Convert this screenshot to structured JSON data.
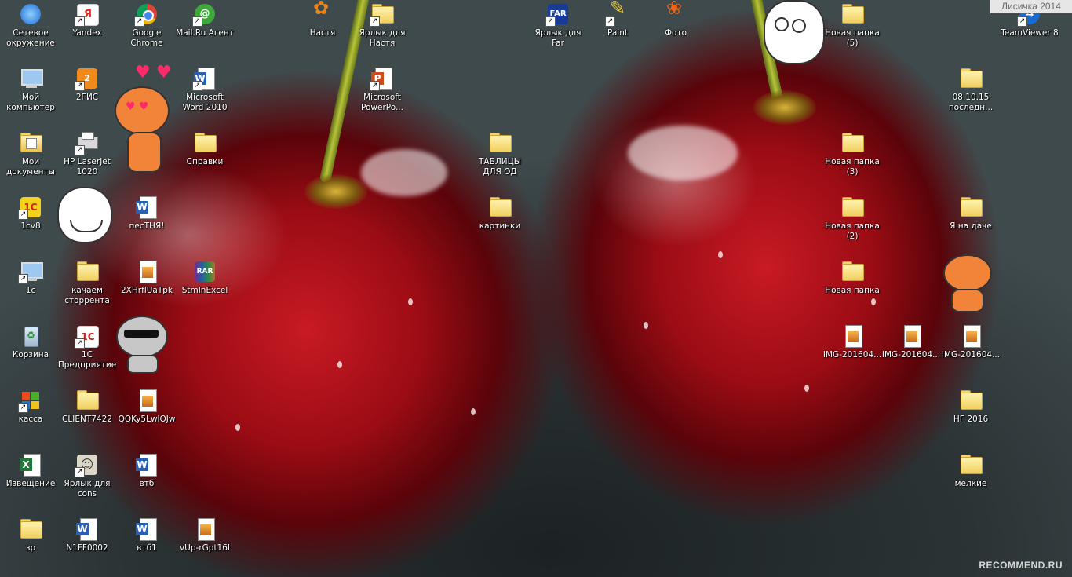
{
  "watermarks": {
    "top_right": "Лисичка 2014",
    "bottom_right": "RECOMMEND.RU"
  },
  "colors": {
    "folder": "#f0cf5e",
    "word_blue": "#2b5fb4",
    "onec_red": "#d0201a",
    "label_text": "#ffffff"
  },
  "icons": [
    {
      "id": "network",
      "label": "Сетевое\nокружение",
      "type": "network",
      "shortcut": false
    },
    {
      "id": "yandex",
      "label": "Yandex",
      "type": "yandex",
      "shortcut": true
    },
    {
      "id": "chrome",
      "label": "Google\nChrome",
      "type": "chrome",
      "shortcut": true
    },
    {
      "id": "mailru",
      "label": "Mail.Ru Агент",
      "type": "mailru",
      "shortcut": true
    },
    {
      "id": "nastya",
      "label": "Настя",
      "type": "butterfly",
      "shortcut": false
    },
    {
      "id": "shortcut-nastya",
      "label": "Ярлык для\nНастя",
      "type": "folder",
      "shortcut": true
    },
    {
      "id": "far",
      "label": "Ярлык для\nFar",
      "type": "far",
      "shortcut": true
    },
    {
      "id": "paint",
      "label": "Paint",
      "type": "paint",
      "shortcut": true
    },
    {
      "id": "foto",
      "label": "Фото",
      "type": "flower",
      "shortcut": false
    },
    {
      "id": "new-folder-5",
      "label": "Новая папка\n(5)",
      "type": "folder",
      "shortcut": false
    },
    {
      "id": "teamviewer",
      "label": "TeamViewer 8",
      "type": "teamviewer",
      "shortcut": true
    },
    {
      "id": "my-computer",
      "label": "Мой\nкомпьютер",
      "type": "computer",
      "shortcut": false
    },
    {
      "id": "2gis",
      "label": "2ГИС",
      "type": "2gis",
      "shortcut": true
    },
    {
      "id": "word2010",
      "label": "Microsoft\nWord 2010",
      "type": "word",
      "shortcut": true
    },
    {
      "id": "powerpoint",
      "label": "Microsoft\nPowerPo...",
      "type": "powerpoint",
      "shortcut": true
    },
    {
      "id": "folder-date",
      "label": "08.10.15\nпоследн...",
      "type": "folder",
      "shortcut": false
    },
    {
      "id": "my-documents",
      "label": "Мои\nдокументы",
      "type": "mydocs",
      "shortcut": false
    },
    {
      "id": "hp-printer",
      "label": "HP LaserJet\n1020",
      "type": "printer",
      "shortcut": true
    },
    {
      "id": "spravki",
      "label": "Справки",
      "type": "folder",
      "shortcut": false
    },
    {
      "id": "tablicy",
      "label": "ТАБЛИЦЫ\nДЛЯ ОД",
      "type": "folder",
      "shortcut": false
    },
    {
      "id": "new-folder-3",
      "label": "Новая папка\n(3)",
      "type": "folder",
      "shortcut": false
    },
    {
      "id": "1cv8",
      "label": "1cv8",
      "type": "onec",
      "shortcut": true
    },
    {
      "id": "pesnya",
      "label": "песТНЯ!",
      "type": "worddoc",
      "shortcut": false
    },
    {
      "id": "kartinki",
      "label": "картинки",
      "type": "folder",
      "shortcut": false
    },
    {
      "id": "new-folder-2",
      "label": "Новая папка\n(2)",
      "type": "folder",
      "shortcut": false
    },
    {
      "id": "ya-na-dache",
      "label": "Я на даче",
      "type": "folder",
      "shortcut": false
    },
    {
      "id": "1c",
      "label": "1с",
      "type": "computer",
      "shortcut": true
    },
    {
      "id": "kachaem",
      "label": "качаем\nсторрента",
      "type": "folder",
      "shortcut": false
    },
    {
      "id": "img-2xhr",
      "label": "2XHrflUaTpk",
      "type": "image",
      "shortcut": false
    },
    {
      "id": "stmin",
      "label": "StmInExcel",
      "type": "rar",
      "shortcut": false
    },
    {
      "id": "new-folder",
      "label": "Новая папка",
      "type": "folder",
      "shortcut": false
    },
    {
      "id": "recycle",
      "label": "Корзина",
      "type": "recycle",
      "shortcut": false
    },
    {
      "id": "1c-enterprise",
      "label": "1С\nПредприятие",
      "type": "onec2",
      "shortcut": true
    },
    {
      "id": "img-1",
      "label": "IMG-201604...",
      "type": "image",
      "shortcut": false
    },
    {
      "id": "img-2",
      "label": "IMG-201604...",
      "type": "image",
      "shortcut": false
    },
    {
      "id": "img-3",
      "label": "IMG-201604...",
      "type": "image",
      "shortcut": false
    },
    {
      "id": "kassa",
      "label": "касса",
      "type": "windows",
      "shortcut": true
    },
    {
      "id": "client",
      "label": "CLIENT7422",
      "type": "folder",
      "shortcut": false
    },
    {
      "id": "qqky",
      "label": "QQKy5LwlOJw",
      "type": "image",
      "shortcut": false
    },
    {
      "id": "ng2016",
      "label": "НГ 2016",
      "type": "folder",
      "shortcut": false
    },
    {
      "id": "izveshenie",
      "label": "Извещение",
      "type": "excel",
      "shortcut": false
    },
    {
      "id": "cons",
      "label": "Ярлык для\ncons",
      "type": "cons",
      "shortcut": true
    },
    {
      "id": "vtb",
      "label": "втб",
      "type": "worddoc",
      "shortcut": false
    },
    {
      "id": "melkie",
      "label": "мелкие",
      "type": "folder",
      "shortcut": false
    },
    {
      "id": "zr",
      "label": "зр",
      "type": "folder",
      "shortcut": false
    },
    {
      "id": "n1ff",
      "label": "N1FF0002",
      "type": "worddoc",
      "shortcut": false
    },
    {
      "id": "vtb1",
      "label": "втб1",
      "type": "worddoc",
      "shortcut": false
    },
    {
      "id": "vup",
      "label": "vUp-rGpt16I",
      "type": "image",
      "shortcut": false
    }
  ]
}
